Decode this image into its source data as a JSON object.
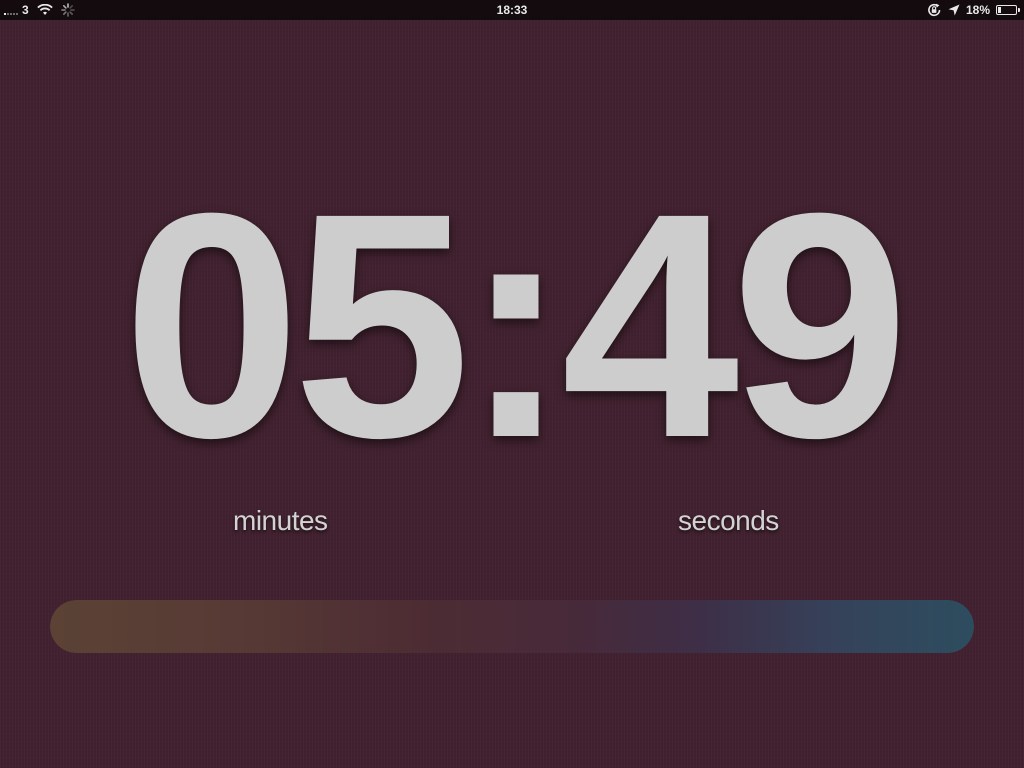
{
  "status_bar": {
    "carrier": "3",
    "time": "18:33",
    "battery_percent": "18%",
    "battery_level": 0.18,
    "icons": [
      "signal-icon",
      "wifi-icon",
      "activity-spinner-icon",
      "rotation-lock-icon",
      "location-arrow-icon",
      "battery-icon"
    ]
  },
  "timer": {
    "display": "05:49",
    "minutes_label": "minutes",
    "seconds_label": "seconds"
  },
  "progress": {
    "fraction": 1.0,
    "colors": {
      "start": "#5b4235",
      "end": "#2d4d5f",
      "track": "#4a2a35"
    }
  },
  "colors": {
    "background": "#41212f",
    "digits": "#cdcdcd",
    "status_bar": "#140b0f"
  }
}
